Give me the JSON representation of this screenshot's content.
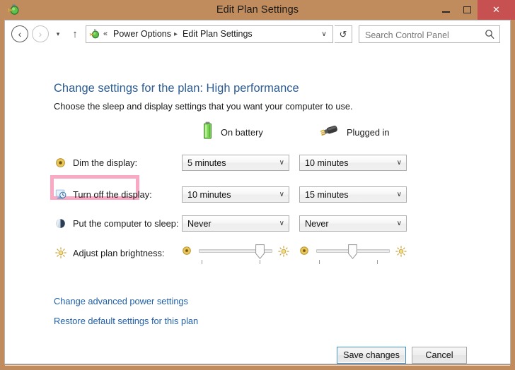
{
  "window": {
    "title": "Edit Plan Settings",
    "icon": "power-options-icon",
    "minimize_label": "–",
    "maximize_label": "□",
    "close_label": "✕",
    "titlebar_color": "#c18c5d",
    "close_button_color": "#c75050"
  },
  "nav": {
    "back_label": "‹",
    "forward_label": "›",
    "recent_label": "▾",
    "up_label": "↑",
    "refresh_label": "↺",
    "address": {
      "icon": "power-options-icon",
      "leading_chevrons": "«",
      "crumb1": "Power Options",
      "separator": "▸",
      "crumb2": "Edit Plan Settings",
      "dropdown_label": "∨"
    },
    "search": {
      "placeholder": "Search Control Panel",
      "value": "",
      "icon": "search-icon"
    }
  },
  "page": {
    "heading": "Change settings for the plan: High performance",
    "heading_color": "#2c5d94",
    "subtitle": "Choose the sleep and display settings that you want your computer to use.",
    "columns": [
      {
        "id": "on-battery",
        "label": "On battery",
        "icon": "battery-icon"
      },
      {
        "id": "plugged-in",
        "label": "Plugged in",
        "icon": "power-plug-icon"
      }
    ],
    "rows": [
      {
        "id": "dim-the-display",
        "label": "Dim the display:",
        "icon": "dim-display-icon",
        "type": "dropdown",
        "battery_value": "5 minutes",
        "plugged_value": "10 minutes",
        "highlighted": true,
        "highlight_color": "#f9a9c4"
      },
      {
        "id": "turn-off-the-display",
        "label": "Turn off the display:",
        "icon": "monitor-clock-icon",
        "type": "dropdown",
        "battery_value": "10 minutes",
        "plugged_value": "15 minutes",
        "highlighted": false
      },
      {
        "id": "put-the-computer-to-sleep",
        "label": "Put the computer to sleep:",
        "icon": "sleep-moon-icon",
        "type": "dropdown",
        "battery_value": "Never",
        "plugged_value": "Never",
        "highlighted": false
      },
      {
        "id": "adjust-plan-brightness",
        "label": "Adjust plan brightness:",
        "icon": "brightness-sun-icon",
        "type": "slider",
        "battery_value": 86,
        "plugged_value": 50,
        "min_icon": "brightness-low-icon",
        "max_icon": "brightness-high-icon",
        "highlighted": false
      }
    ],
    "dropdown_arrow": "∨",
    "links": [
      {
        "id": "change-advanced-power-settings",
        "label": "Change advanced power settings"
      },
      {
        "id": "restore-default-settings",
        "label": "Restore default settings for this plan"
      }
    ]
  },
  "footer": {
    "save_label": "Save changes",
    "cancel_label": "Cancel"
  }
}
